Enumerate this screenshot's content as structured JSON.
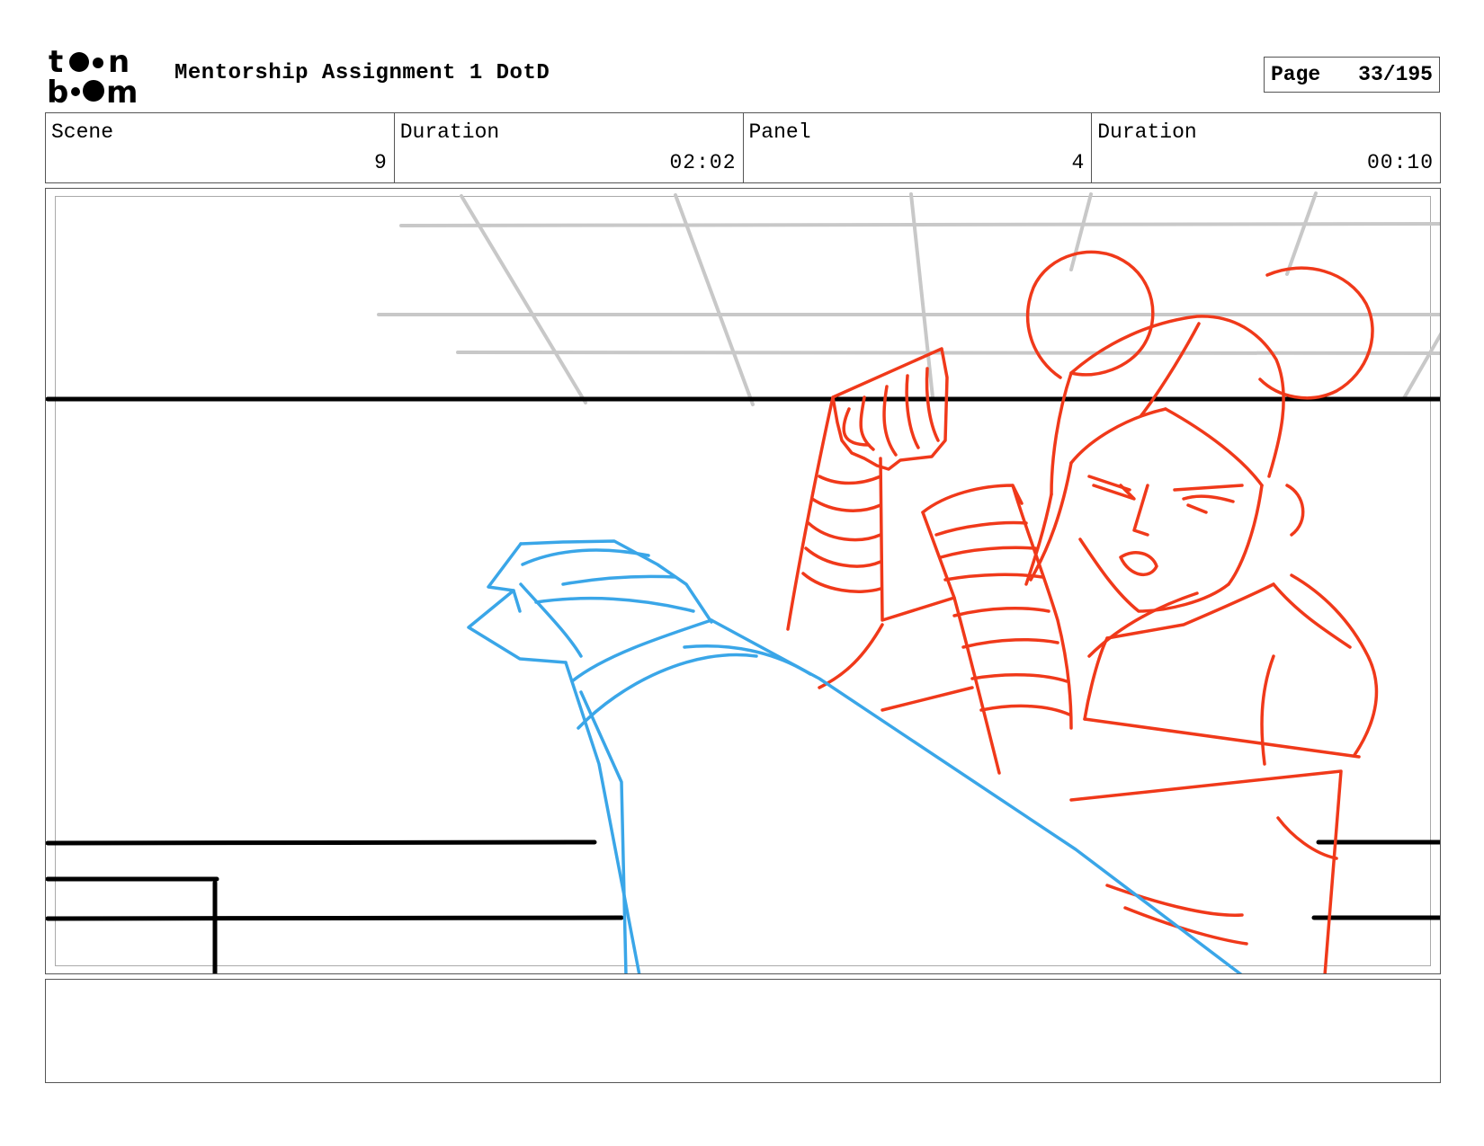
{
  "logo": {
    "top_text": "toon",
    "bottom_text": "boom"
  },
  "document": {
    "title": "Mentorship Assignment 1 DotD"
  },
  "page": {
    "label": "Page",
    "value": "33/195"
  },
  "info": {
    "scene_label": "Scene",
    "scene_value": "9",
    "scene_duration_label": "Duration",
    "scene_duration_value": "02:02",
    "panel_label": "Panel",
    "panel_value": "4",
    "panel_duration_label": "Duration",
    "panel_duration_value": "00:10"
  },
  "colors": {
    "background_lines": "#000000",
    "ceiling_grid": "#c8c8c8",
    "character_sketch": "#f0391a",
    "foreground_leg_sketch": "#3aa6e8"
  },
  "notes": {
    "text": ""
  }
}
